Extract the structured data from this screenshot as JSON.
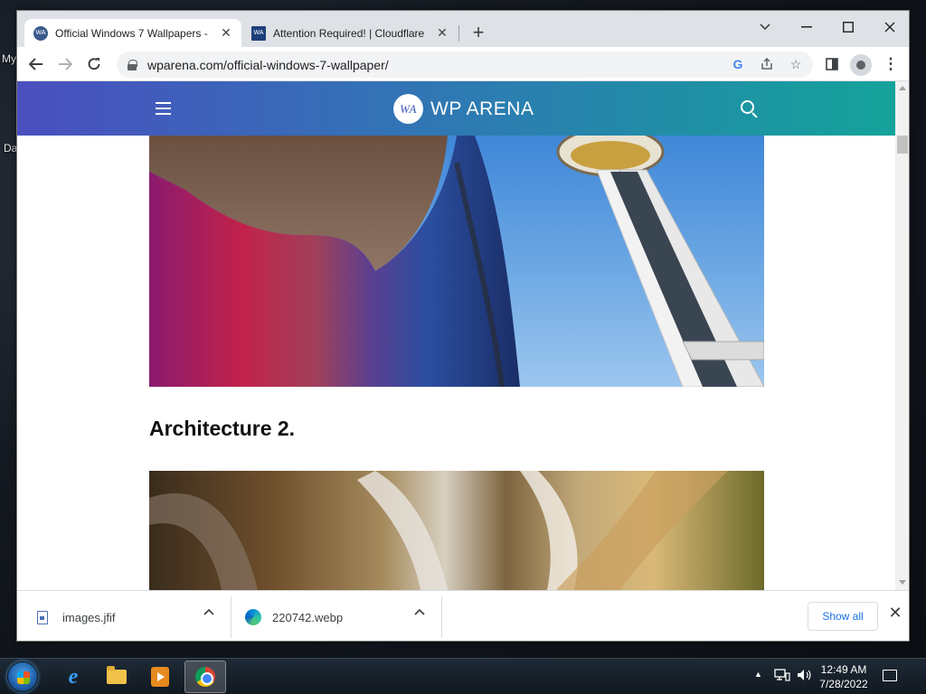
{
  "desktop": {
    "labels": [
      "My",
      "Da"
    ]
  },
  "browser": {
    "tabs": [
      {
        "title": "Official Windows 7 Wallpapers -",
        "favicon": "WA",
        "active": true
      },
      {
        "title": "Attention Required! | Cloudflare",
        "favicon": "WA",
        "active": false
      }
    ],
    "new_tab_label": "+",
    "url": "wparena.com/official-windows-7-wallpaper/"
  },
  "site": {
    "logo_mark": "WA",
    "logo_text": "WP ARENA",
    "heading": "Architecture 2."
  },
  "downloads": {
    "items": [
      {
        "name": "images.jfif",
        "icon": "file-icon"
      },
      {
        "name": "220742.webp",
        "icon": "edge-icon"
      }
    ],
    "show_all_label": "Show all"
  },
  "taskbar": {
    "apps": [
      "internet-explorer",
      "file-explorer",
      "media-player",
      "chrome"
    ],
    "time": "12:49 AM",
    "date": "7/28/2022"
  },
  "colors": {
    "header_gradient_start": "#4a4fbf",
    "header_gradient_end": "#13a39a",
    "link_blue": "#1a73e8"
  }
}
